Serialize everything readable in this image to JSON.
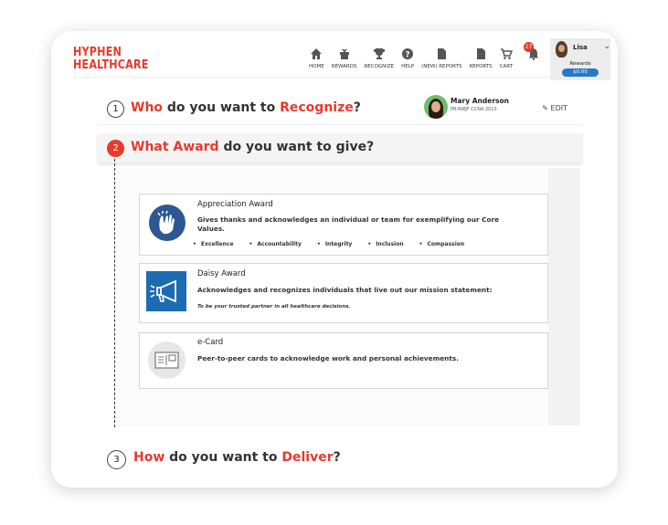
{
  "brand": {
    "logo_line1": "HYPHEN",
    "logo_line2": "HEALTHCARE",
    "color": "#e8392d"
  },
  "nav": [
    {
      "label": "HOME",
      "icon": "home-icon"
    },
    {
      "label": "REWARDS",
      "icon": "gift-icon"
    },
    {
      "label": "RECOGNIZE",
      "icon": "trophy-icon"
    },
    {
      "label": "HELP",
      "icon": "help-icon"
    },
    {
      "label": "(NEW) REPORTS",
      "icon": "document-icon"
    },
    {
      "label": "REPORTS",
      "icon": "document-icon"
    },
    {
      "label": "CART",
      "icon": "cart-icon"
    }
  ],
  "notifications": {
    "count": "27",
    "icon": "bell-icon"
  },
  "user": {
    "name": "Lisa",
    "rewards_label": "Rewards",
    "balance": "$0.00"
  },
  "step1": {
    "number": "1",
    "title_pre": "Who",
    "title_mid": " do you want to ",
    "title_red": "Recognize",
    "title_end": "?",
    "recipient_name": "Mary Anderson",
    "recipient_sub": "PR-RWJF CCNA 2013",
    "edit_label": "✎ EDIT"
  },
  "step2": {
    "number": "2",
    "title_red": "What Award",
    "title_rest": " do you want to give?"
  },
  "awards": [
    {
      "name": "Appreciation Award",
      "description": "Gives thanks and acknowledges an individual or team for exemplifying our Core Values.",
      "values": [
        "Excellence",
        "Accountability",
        "Integrity",
        "Inclusion",
        "Compassion"
      ],
      "icon": "clapping-hands-icon"
    },
    {
      "name": "Daisy Award",
      "description": "Acknowledges and recognizes individuals that live out our mission statement:",
      "subtext": "To be your trusted partner in all healthcare decisions.",
      "icon": "megaphone-icon"
    },
    {
      "name": "e-Card",
      "description": "Peer-to-peer cards to acknowledge work and personal achievements.",
      "icon": "ecard-icon"
    }
  ],
  "step3": {
    "number": "3",
    "title_pre": "How",
    "title_mid": " do you want to ",
    "title_red": "Deliver",
    "title_end": "?"
  },
  "colors": {
    "accent": "#e8392d",
    "blue": "#2a77c6",
    "navy": "#2d5793"
  }
}
